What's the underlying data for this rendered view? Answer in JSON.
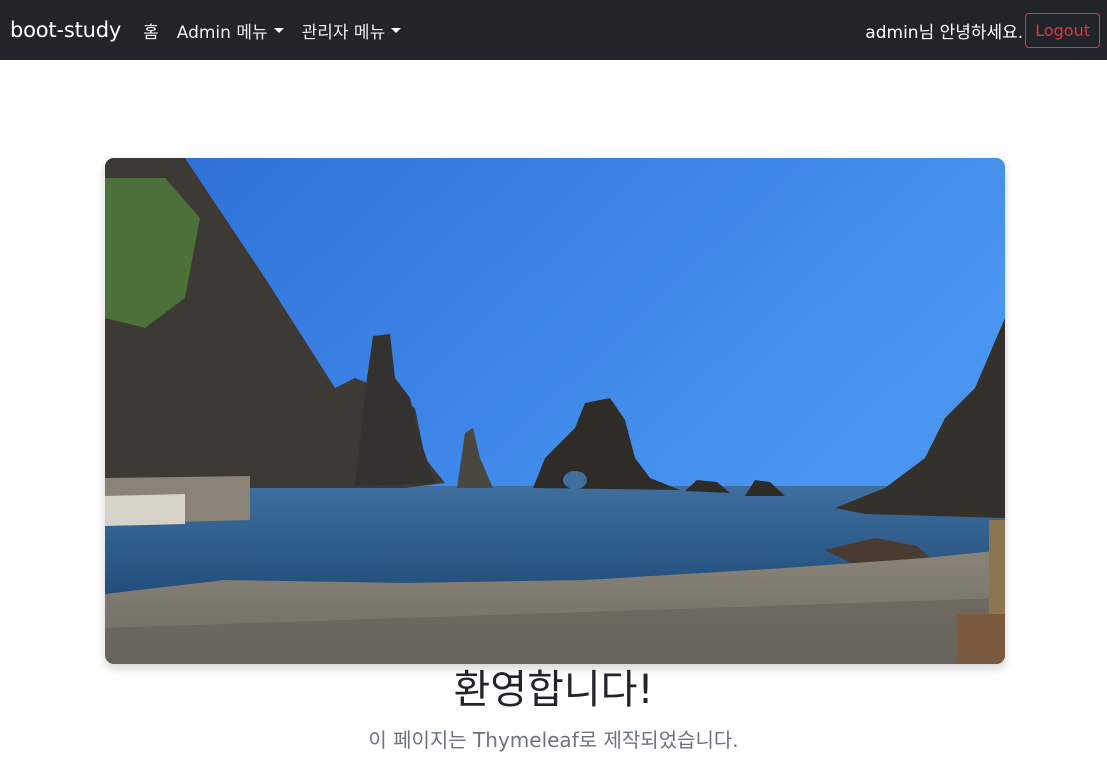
{
  "navbar": {
    "brand": "boot-study",
    "items": [
      {
        "label": "홈",
        "dropdown": false
      },
      {
        "label": "Admin 메뉴",
        "dropdown": true
      },
      {
        "label": "관리자 메뉴",
        "dropdown": true
      }
    ],
    "greeting": "admin님 안녕하세요.",
    "logout_label": "Logout"
  },
  "colors": {
    "navbar_bg": "#212529",
    "logout_accent": "#dc3545",
    "subtitle_text": "#6c757d"
  },
  "main": {
    "title": "환영합니다!",
    "subtitle": "이 페이지는 Thymeleaf로 제작되었습니다."
  }
}
